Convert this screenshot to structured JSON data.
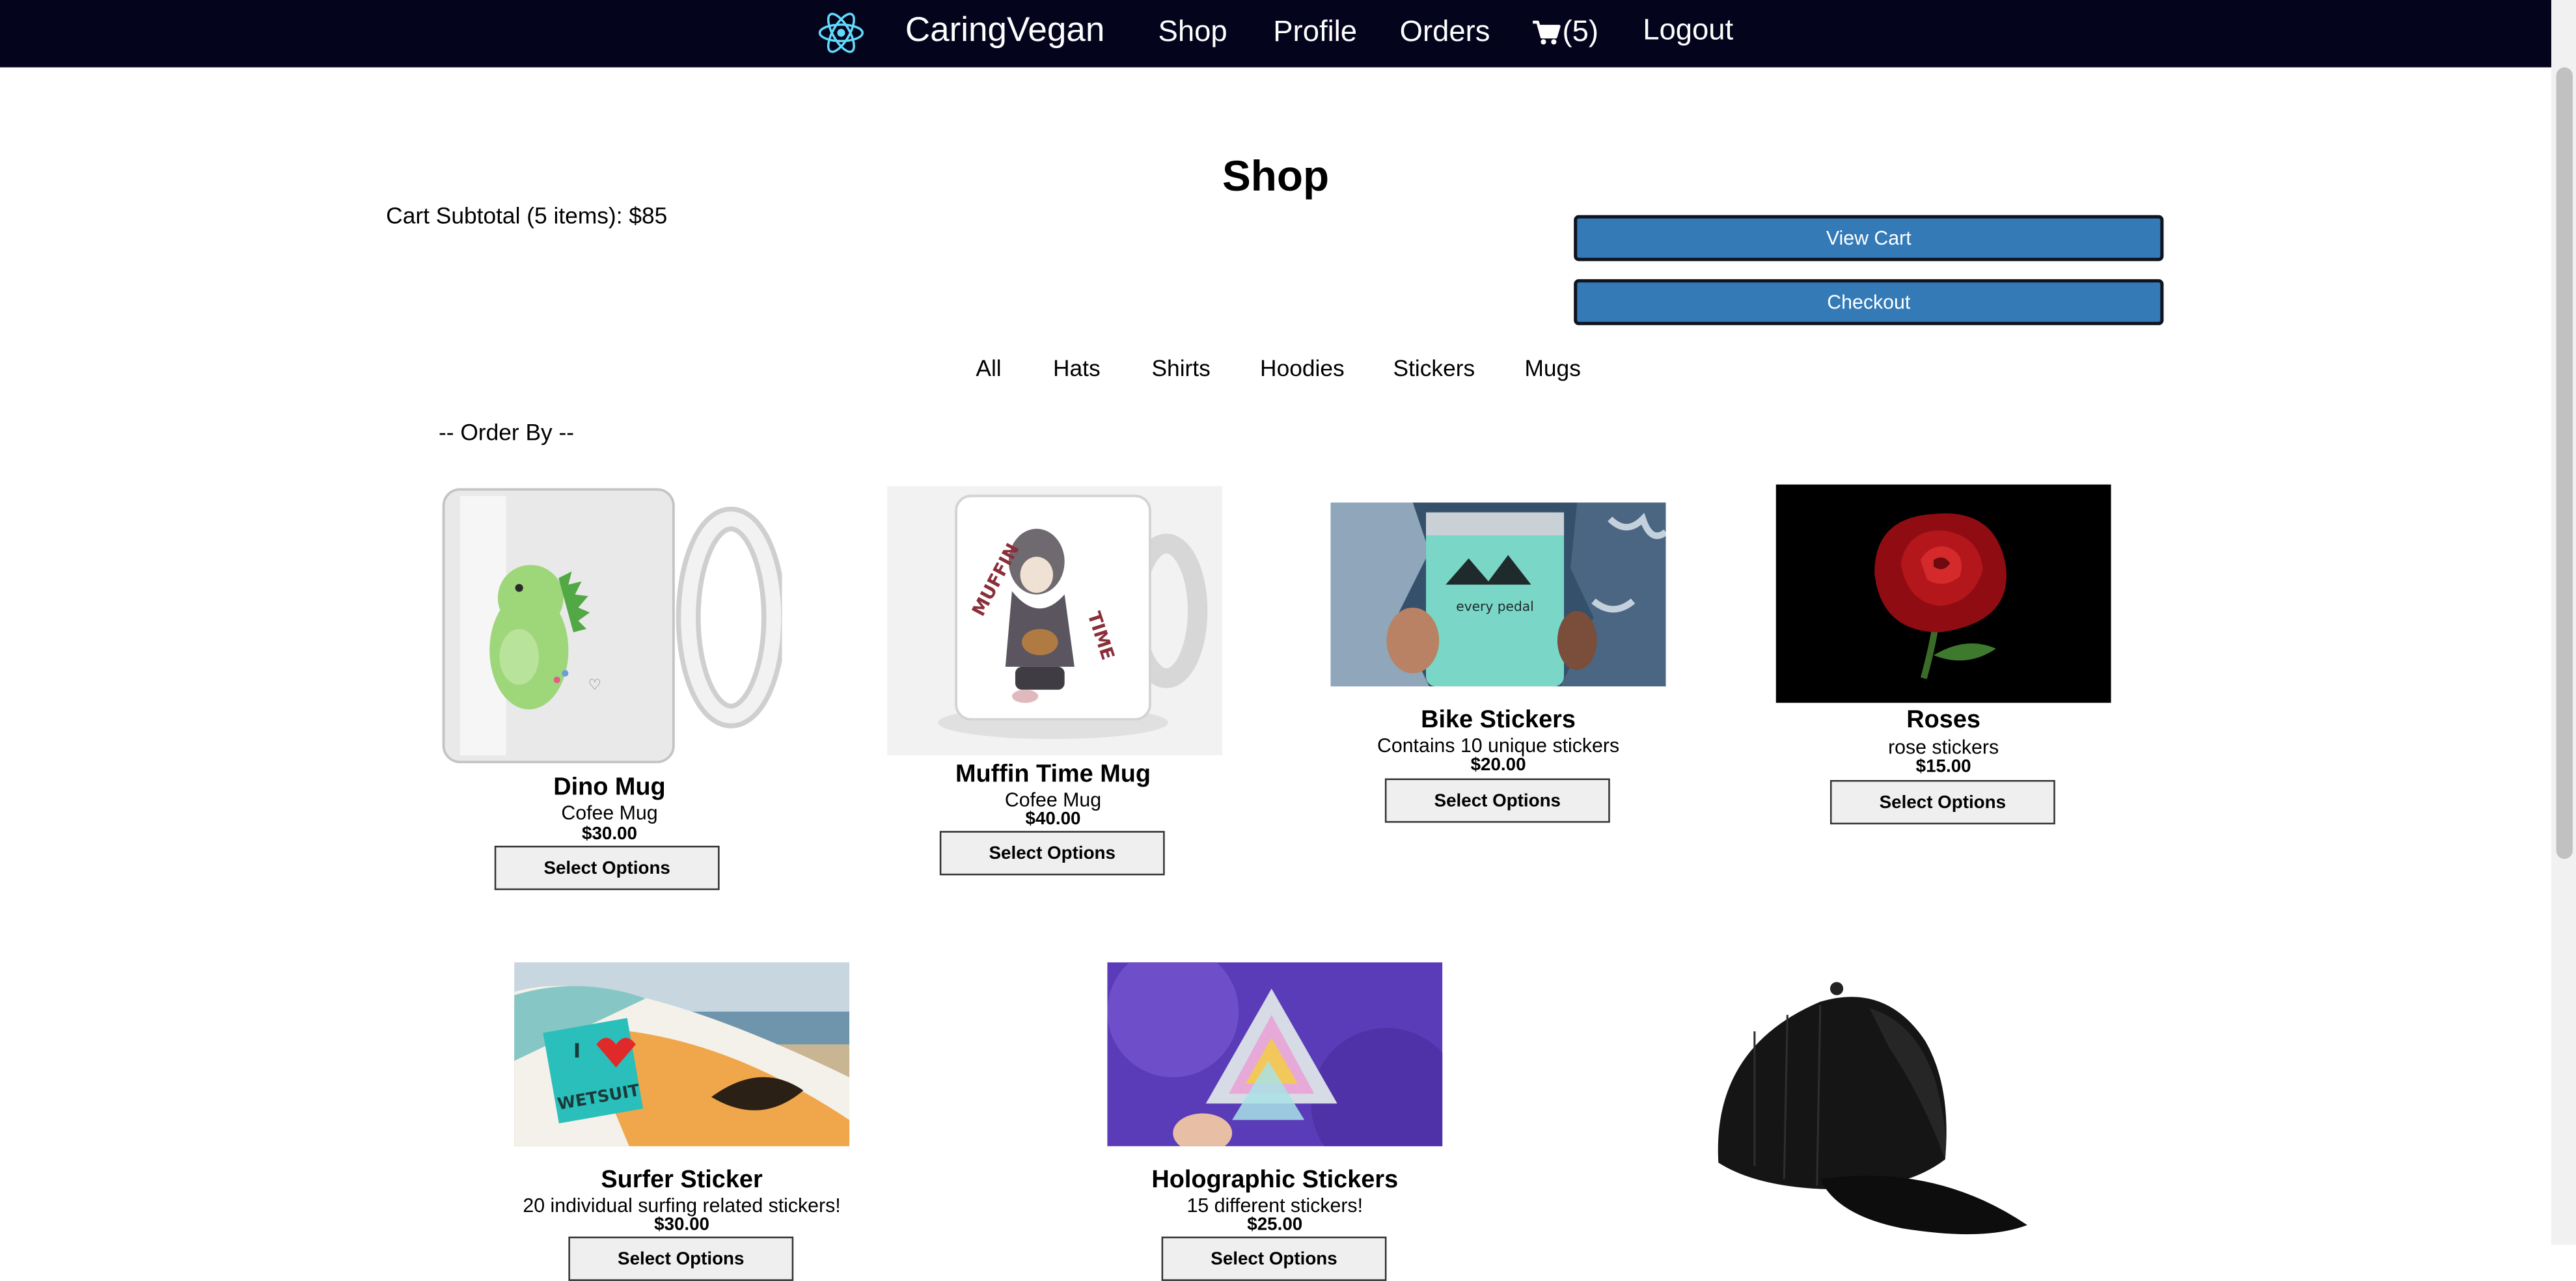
{
  "navbar": {
    "brand": "CaringVegan",
    "links": [
      "Shop",
      "Profile",
      "Orders"
    ],
    "cart_count": "(5)",
    "logout": "Logout",
    "logo_icon": "react-atom-icon",
    "cart_icon": "shopping-cart-icon"
  },
  "page": {
    "title": "Shop",
    "subtotal": "Cart Subtotal (5 items): $85",
    "view_cart": "View Cart",
    "checkout": "Checkout",
    "order_by": "-- Order By --"
  },
  "categories": [
    "All",
    "Hats",
    "Shirts",
    "Hoodies",
    "Stickers",
    "Mugs"
  ],
  "products": [
    {
      "name": "Dino Mug",
      "description": "Cofee Mug",
      "price": "$30.00",
      "button": "Select Options"
    },
    {
      "name": "Muffin Time Mug",
      "description": "Cofee Mug",
      "price": "$40.00",
      "button": "Select Options"
    },
    {
      "name": "Bike Stickers",
      "description": "Contains 10 unique stickers",
      "price": "$20.00",
      "button": "Select Options"
    },
    {
      "name": "Roses",
      "description": "rose stickers",
      "price": "$15.00",
      "button": "Select Options"
    },
    {
      "name": "Surfer Sticker",
      "description": "20 individual surfing related stickers!",
      "price": "$30.00",
      "button": "Select Options"
    },
    {
      "name": "Holographic Stickers",
      "description": "15 different stickers!",
      "price": "$25.00",
      "button": "Select Options"
    }
  ],
  "image_text": {
    "mug2_word1": "MUFFIN",
    "mug2_word2": "TIME",
    "surfer_line1": "I",
    "surfer_line2": "WETSUIT",
    "bike_caption": "every pedal"
  },
  "colors": {
    "navbar_bg": "#05041d",
    "accent_button": "#337ab7",
    "logo": "#61dafb"
  }
}
